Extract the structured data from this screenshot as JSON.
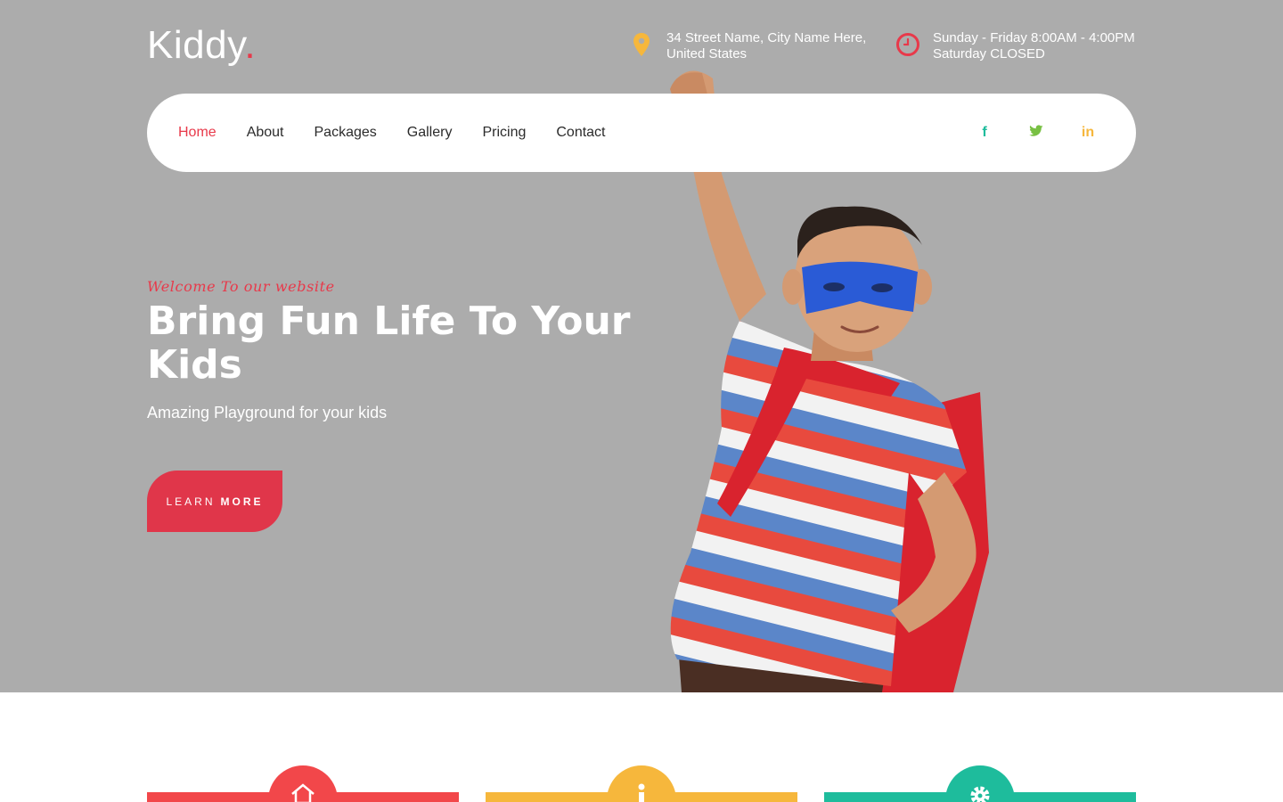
{
  "header": {
    "logo": {
      "text": "Kiddy",
      "dot": "."
    },
    "address": {
      "line1": "34 Street Name, City Name Here,",
      "line2": "United States"
    },
    "hours": {
      "line1": "Sunday - Friday 8:00AM - 4:00PM",
      "line2": "Saturday CLOSED"
    }
  },
  "nav": {
    "items": [
      {
        "label": "Home",
        "active": true
      },
      {
        "label": "About",
        "active": false
      },
      {
        "label": "Packages",
        "active": false
      },
      {
        "label": "Gallery",
        "active": false
      },
      {
        "label": "Pricing",
        "active": false
      },
      {
        "label": "Contact",
        "active": false
      }
    ],
    "social": [
      {
        "glyph": "f",
        "icon": "facebook-icon",
        "color": "#1ebc9c"
      },
      {
        "glyph": "t",
        "icon": "twitter-icon",
        "color": "#78c043"
      },
      {
        "glyph": "in",
        "icon": "linkedin-icon",
        "color": "#f6b73c"
      }
    ]
  },
  "hero": {
    "welcome": "Welcome To our website",
    "headline": "Bring Fun Life To Your Kids",
    "subtitle": "Amazing Playground for your kids",
    "cta": {
      "light": "LEARN",
      "bold": "MORE"
    }
  },
  "features": [
    {
      "icon": "home-icon",
      "color": "#f2474a"
    },
    {
      "icon": "info-icon",
      "color": "#f6b73c"
    },
    {
      "icon": "gear-icon",
      "color": "#1ebc9c"
    }
  ],
  "colors": {
    "accent": "#e8394a",
    "hero_background": "#acacac",
    "location_icon": "#f6b73c",
    "clock_icon": "#e8394a"
  }
}
